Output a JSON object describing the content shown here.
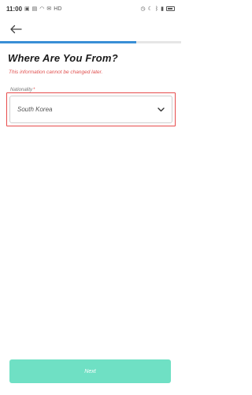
{
  "status_bar": {
    "time": "11:00",
    "left_icons": [
      "image-icon",
      "sim-icon",
      "wifi-icon",
      "mail-icon"
    ],
    "network_label": "HD",
    "right_icons": [
      "alarm-icon",
      "moon-icon",
      "bluetooth-icon",
      "signal-icon",
      "battery-icon"
    ]
  },
  "header": {
    "back_icon": "arrow-left-icon"
  },
  "progress": {
    "fraction": 0.75,
    "fill_color": "#3a8fd6"
  },
  "main": {
    "title": "Where Are You From?",
    "warning": "This information cannot be changed later.",
    "nationality": {
      "label": "Nationality",
      "required_mark": "*",
      "selected_value": "South Korea",
      "dropdown_icon": "chevron-down-icon"
    }
  },
  "footer": {
    "next_label": "Next",
    "button_color": "#6fe0c4"
  },
  "colors": {
    "warning": "#e0504f",
    "highlight_border": "#e74c4c"
  }
}
